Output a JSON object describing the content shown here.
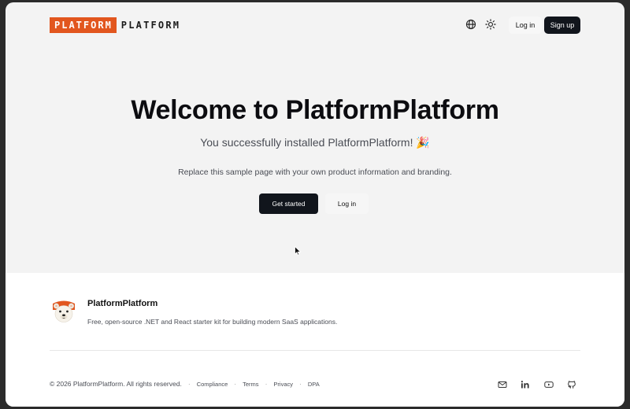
{
  "header": {
    "logo_box": "PLATFORM",
    "logo_text": "PLATFORM",
    "icons": [
      "globe-icon",
      "sun-icon"
    ],
    "login_label": "Log in",
    "signup_label": "Sign up"
  },
  "hero": {
    "title": "Welcome to PlatformPlatform",
    "subtitle": "You successfully installed PlatformPlatform! 🎉",
    "description": "Replace this sample page with your own product information and branding.",
    "get_started_label": "Get started",
    "login_label": "Log in"
  },
  "footer": {
    "name": "PlatformPlatform",
    "tagline": "Free, open-source .NET and React starter kit for building modern SaaS applications.",
    "copyright": "© 2026 PlatformPlatform. All rights reserved.",
    "links": [
      "Compliance",
      "Terms",
      "Privacy",
      "DPA"
    ],
    "social_icons": [
      "mail-icon",
      "linkedin-icon",
      "youtube-icon",
      "github-icon"
    ]
  },
  "colors": {
    "accent": "#e2561e",
    "primary_button": "#11151c",
    "hero_background": "#f3f3f3",
    "footer_background": "#ffffff"
  }
}
